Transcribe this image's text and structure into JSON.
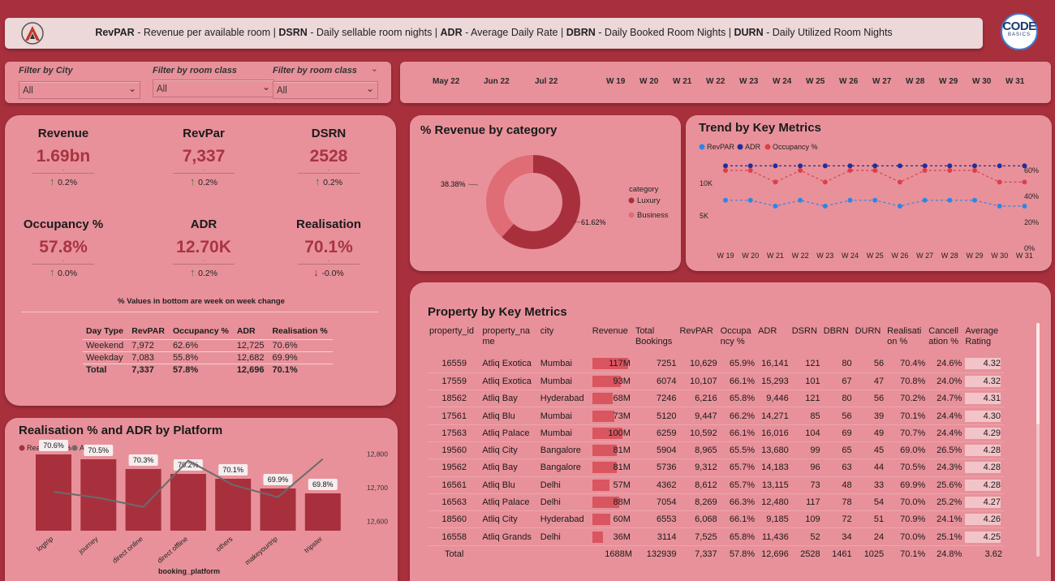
{
  "header": {
    "legend": [
      {
        "term": "RevPAR",
        "desc": " - Revenue per available room | "
      },
      {
        "term": "DSRN",
        "desc": " - Daily sellable room nights | "
      },
      {
        "term": "ADR",
        "desc": " - Average Daily Rate | "
      },
      {
        "term": "DBRN",
        "desc": " - Daily Booked Room Nights | "
      },
      {
        "term": "DURN",
        "desc": " - Daily Utilized Room Nights"
      }
    ],
    "brand": {
      "line1": "CODE",
      "line2": "BASICS"
    }
  },
  "filters": [
    {
      "label": "Filter by City",
      "value": "All"
    },
    {
      "label": "Filter by room class",
      "value": "All"
    },
    {
      "label": "Filter by room class",
      "value": "All"
    }
  ],
  "timeline": {
    "months": [
      "May 22",
      "Jun 22",
      "Jul 22"
    ],
    "weeks": [
      "W 19",
      "W 20",
      "W 21",
      "W 22",
      "W 23",
      "W 24",
      "W 25",
      "W 26",
      "W 27",
      "W 28",
      "W 29",
      "W 30",
      "W 31"
    ]
  },
  "kpis": [
    {
      "title": "Revenue",
      "value": "1.69bn",
      "change": "0.2%",
      "dir": "up"
    },
    {
      "title": "RevPar",
      "value": "7,337",
      "change": "0.2%",
      "dir": "up"
    },
    {
      "title": "DSRN",
      "value": "2528",
      "change": "0.2%",
      "dir": "up"
    },
    {
      "title": "Occupancy %",
      "value": "57.8%",
      "change": "0.0%",
      "dir": "up"
    },
    {
      "title": "ADR",
      "value": "12.70K",
      "change": "0.2%",
      "dir": "up"
    },
    {
      "title": "Realisation",
      "value": "70.1%",
      "change": "-0.0%",
      "dir": "down"
    }
  ],
  "kpi_note": "% Values in bottom are week on week change",
  "daytype_table": {
    "headers": [
      "Day Type",
      "RevPAR",
      "Occupancy %",
      "ADR",
      "Realisation %"
    ],
    "rows": [
      [
        "Weekend",
        "7,972",
        "62.6%",
        "12,725",
        "70.6%"
      ],
      [
        "Weekday",
        "7,083",
        "55.8%",
        "12,682",
        "69.9%"
      ]
    ],
    "total": [
      "Total",
      "7,337",
      "57.8%",
      "12,696",
      "70.1%"
    ]
  },
  "revenue_by_category": {
    "title": "% Revenue by category",
    "legend_title": "category",
    "colors": {
      "Luxury": "#a8303d",
      "Business": "#e06c76"
    }
  },
  "trend": {
    "title": "Trend by Key Metrics",
    "colors": {
      "RevPAR": "#2e86e6",
      "ADR": "#1f2f9c",
      "Occupancy %": "#d9404c"
    },
    "left_ticks": [
      "10K",
      "5K"
    ],
    "right_ticks": [
      "60%",
      "40%",
      "20%",
      "0%"
    ]
  },
  "platform_chart": {
    "title": "Realisation % and ADR by Platform",
    "right_ticks": [
      "12,800",
      "12,700",
      "12,600"
    ],
    "colors": {
      "Realisation %": "#a8303d",
      "ADR": "#6b6b6b"
    }
  },
  "property_table": {
    "title": "Property by Key Metrics",
    "headers": [
      "property_id",
      "property_na\nme",
      "city",
      "Revenue",
      "Total\nBookings",
      "RevPAR",
      "Occupa\nncy %",
      "ADR",
      "DSRN",
      "DBRN",
      "DURN",
      "Realisati\non %",
      "Cancell\nation %",
      "Average\nRating"
    ],
    "rows": [
      [
        "16559",
        "Atliq Exotica",
        "Mumbai",
        "117M",
        "7251",
        "10,629",
        "65.9%",
        "16,141",
        "121",
        "80",
        "56",
        "70.4%",
        "24.6%",
        "4.32"
      ],
      [
        "17559",
        "Atliq Exotica",
        "Mumbai",
        "93M",
        "6074",
        "10,107",
        "66.1%",
        "15,293",
        "101",
        "67",
        "47",
        "70.8%",
        "24.0%",
        "4.32"
      ],
      [
        "18562",
        "Atliq Bay",
        "Hyderabad",
        "68M",
        "7246",
        "6,216",
        "65.8%",
        "9,446",
        "121",
        "80",
        "56",
        "70.2%",
        "24.7%",
        "4.31"
      ],
      [
        "17561",
        "Atliq Blu",
        "Mumbai",
        "73M",
        "5120",
        "9,447",
        "66.2%",
        "14,271",
        "85",
        "56",
        "39",
        "70.1%",
        "24.4%",
        "4.30"
      ],
      [
        "17563",
        "Atliq Palace",
        "Mumbai",
        "100M",
        "6259",
        "10,592",
        "66.1%",
        "16,016",
        "104",
        "69",
        "49",
        "70.7%",
        "24.4%",
        "4.29"
      ],
      [
        "19560",
        "Atliq City",
        "Bangalore",
        "81M",
        "5904",
        "8,965",
        "65.5%",
        "13,680",
        "99",
        "65",
        "45",
        "69.0%",
        "26.5%",
        "4.28"
      ],
      [
        "19562",
        "Atliq Bay",
        "Bangalore",
        "81M",
        "5736",
        "9,312",
        "65.7%",
        "14,183",
        "96",
        "63",
        "44",
        "70.5%",
        "24.3%",
        "4.28"
      ],
      [
        "16561",
        "Atliq Blu",
        "Delhi",
        "57M",
        "4362",
        "8,612",
        "65.7%",
        "13,115",
        "73",
        "48",
        "33",
        "69.9%",
        "25.6%",
        "4.28"
      ],
      [
        "16563",
        "Atliq Palace",
        "Delhi",
        "88M",
        "7054",
        "8,269",
        "66.3%",
        "12,480",
        "117",
        "78",
        "54",
        "70.0%",
        "25.2%",
        "4.27"
      ],
      [
        "18560",
        "Atliq City",
        "Hyderabad",
        "60M",
        "6553",
        "6,068",
        "66.1%",
        "9,185",
        "109",
        "72",
        "51",
        "70.9%",
        "24.1%",
        "4.26"
      ],
      [
        "16558",
        "Atliq Grands",
        "Delhi",
        "36M",
        "3114",
        "7,525",
        "65.8%",
        "11,436",
        "52",
        "34",
        "24",
        "70.0%",
        "25.1%",
        "4.25"
      ]
    ],
    "total": [
      "Total",
      "",
      "",
      "1688M",
      "132939",
      "7,337",
      "57.8%",
      "12,696",
      "2528",
      "1461",
      "1025",
      "70.1%",
      "24.8%",
      "3.62"
    ],
    "revenue_values_m": [
      117,
      93,
      68,
      73,
      100,
      81,
      81,
      57,
      88,
      60,
      36
    ],
    "rating_values": [
      4.32,
      4.32,
      4.31,
      4.3,
      4.29,
      4.28,
      4.28,
      4.28,
      4.27,
      4.26,
      4.25
    ]
  },
  "chart_data": [
    {
      "type": "pie",
      "title": "% Revenue by category",
      "legend_title": "category",
      "categories": [
        "Luxury",
        "Business"
      ],
      "values": [
        61.62,
        38.38
      ],
      "labels": [
        "61.62%",
        "38.38%"
      ],
      "legend_placement": "right"
    },
    {
      "type": "line",
      "title": "Trend by Key Metrics",
      "x": [
        "W 19",
        "W 20",
        "W 21",
        "W 22",
        "W 23",
        "W 24",
        "W 25",
        "W 26",
        "W 27",
        "W 28",
        "W 29",
        "W 30",
        "W 31"
      ],
      "series": [
        {
          "name": "RevPAR",
          "axis": "left",
          "values": [
            7400,
            7400,
            6500,
            7400,
            6500,
            7400,
            7400,
            6500,
            7400,
            7400,
            7400,
            6500,
            6500
          ]
        },
        {
          "name": "ADR",
          "axis": "left",
          "values": [
            12700,
            12700,
            12700,
            12700,
            12700,
            12700,
            12700,
            12700,
            12700,
            12700,
            12700,
            12700,
            12700
          ]
        },
        {
          "name": "Occupancy %",
          "axis": "right",
          "values": [
            60,
            60,
            51,
            60,
            51,
            60,
            60,
            51,
            60,
            60,
            60,
            51,
            51
          ]
        }
      ],
      "left_ylim": [
        0,
        14000
      ],
      "right_ylim": [
        0,
        70
      ],
      "legend_placement": "top-left"
    },
    {
      "type": "bar",
      "title": "Realisation % and ADR by Platform",
      "xlabel": "booking_platform",
      "categories": [
        "logtrip",
        "journey",
        "direct online",
        "direct offline",
        "others",
        "makeyourtrip",
        "tripster"
      ],
      "series": [
        {
          "name": "Realisation %",
          "type": "bar",
          "values": [
            70.6,
            70.5,
            70.3,
            70.2,
            70.1,
            69.9,
            69.8
          ],
          "labels": [
            "70.6%",
            "70.5%",
            "70.3%",
            "70.2%",
            "70.1%",
            "69.9%",
            "69.8%"
          ]
        },
        {
          "name": "ADR",
          "type": "line",
          "axis": "right",
          "values": [
            12688,
            12670,
            12643,
            12780,
            12708,
            12672,
            12785
          ]
        }
      ],
      "right_ylim": [
        12580,
        12820
      ],
      "legend_placement": "top-left"
    }
  ]
}
